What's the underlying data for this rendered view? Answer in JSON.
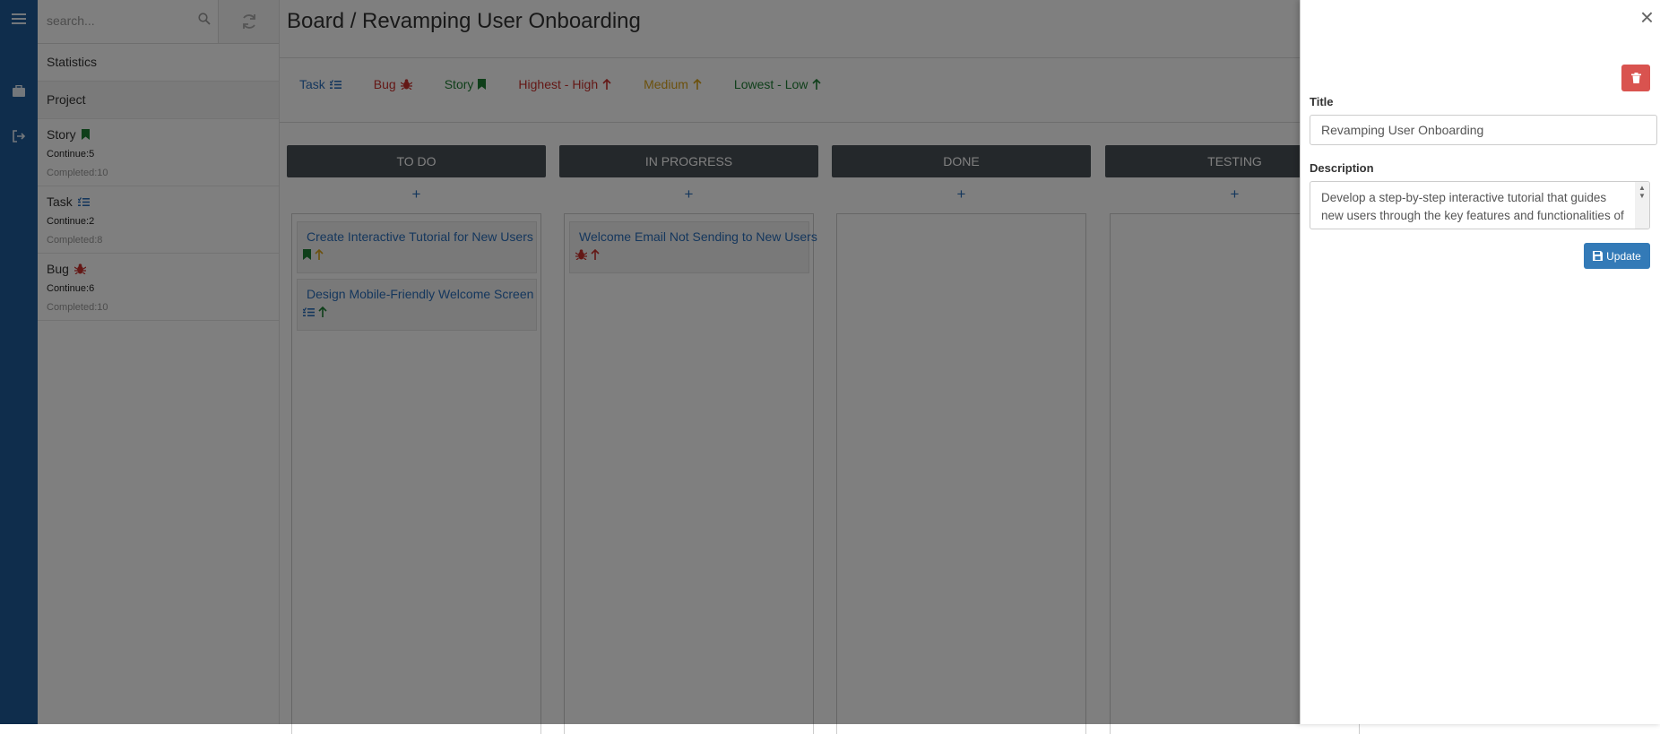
{
  "search": {
    "placeholder": "search..."
  },
  "sidebar": {
    "nav": [
      {
        "label": "Statistics"
      },
      {
        "label": "Project"
      }
    ],
    "types": [
      {
        "name": "Story",
        "icon": "bookmark-icon",
        "color": "#1e7e34",
        "continue": "Continue:5",
        "completed": "Completed:10"
      },
      {
        "name": "Task",
        "icon": "list-check-icon",
        "color": "#2a6ebb",
        "continue": "Continue:2",
        "completed": "Completed:8"
      },
      {
        "name": "Bug",
        "icon": "bug-icon",
        "color": "#c9302c",
        "continue": "Continue:6",
        "completed": "Completed:10"
      }
    ]
  },
  "board": {
    "title": "Board / Revamping User Onboarding",
    "legend": [
      {
        "label": "Task",
        "icon": "list-check-icon",
        "color": "#2a6ebb"
      },
      {
        "label": "Bug",
        "icon": "bug-icon",
        "color": "#c9302c"
      },
      {
        "label": "Story",
        "icon": "bookmark-icon",
        "color": "#1e7e34"
      },
      {
        "label": "Highest - High",
        "icon": "arrow-up-icon",
        "color": "#c9302c"
      },
      {
        "label": "Medium",
        "icon": "arrow-up-icon",
        "color": "#d9a21b"
      },
      {
        "label": "Lowest - Low",
        "icon": "arrow-up-icon",
        "color": "#1e7e34"
      }
    ],
    "columns": [
      {
        "name": "TO DO",
        "add": "+",
        "cards": [
          {
            "title": "Create Interactive Tutorial for New Users",
            "type": "story",
            "priority": "medium"
          },
          {
            "title": "Design Mobile-Friendly Welcome Screen",
            "type": "task",
            "priority": "low"
          }
        ]
      },
      {
        "name": "IN PROGRESS",
        "add": "+",
        "cards": [
          {
            "title": "Welcome Email Not Sending to New Users",
            "type": "bug",
            "priority": "high"
          }
        ]
      },
      {
        "name": "DONE",
        "add": "+",
        "cards": []
      },
      {
        "name": "TESTING",
        "add": "+",
        "cards": []
      }
    ]
  },
  "drawer": {
    "close": "×",
    "title_label": "Title",
    "title_value": "Revamping User Onboarding",
    "description_label": "Description",
    "description_value": "Develop a step-by-step interactive tutorial that guides new users through the key features and functionalities of the application.",
    "update_label": "Update"
  }
}
